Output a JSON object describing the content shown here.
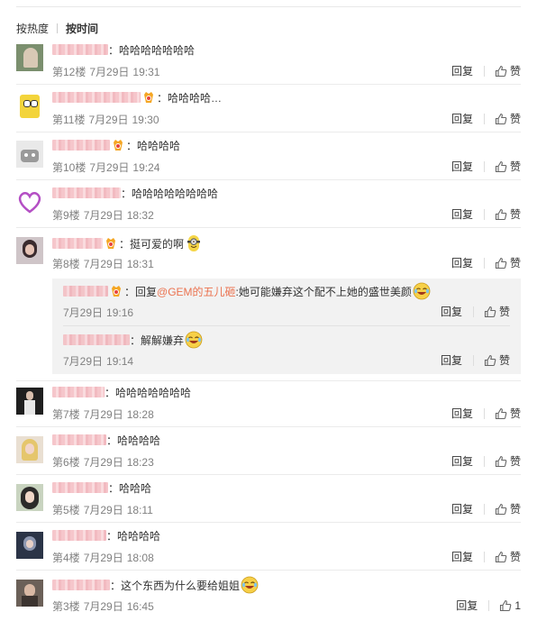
{
  "sort": {
    "hot": "按热度",
    "time": "按时间"
  },
  "actions": {
    "reply": "回复",
    "like": "赞"
  },
  "colors": {
    "link": "#eb7350",
    "meta": "#808080",
    "text": "#333333"
  },
  "comments": [
    {
      "floor": "第12楼",
      "date": "7月29日",
      "time": "19:31",
      "text": "：哈哈哈哈哈哈哈",
      "vip": false,
      "likes": ""
    },
    {
      "floor": "第11楼",
      "date": "7月29日",
      "time": "19:30",
      "text": "：哈哈哈哈…",
      "vip": true,
      "likes": ""
    },
    {
      "floor": "第10楼",
      "date": "7月29日",
      "time": "19:24",
      "text": "：哈哈哈哈",
      "vip": true,
      "likes": ""
    },
    {
      "floor": "第9楼",
      "date": "7月29日",
      "time": "18:32",
      "text": "：哈哈哈哈哈哈哈哈",
      "vip": false,
      "likes": ""
    },
    {
      "floor": "第8楼",
      "date": "7月29日",
      "time": "18:31",
      "text": "：挺可爱的啊",
      "vip": true,
      "likes": "",
      "replies": [
        {
          "date": "7月29日",
          "time": "19:16",
          "prefix": "：回复",
          "mention": "@GEM的五儿砸",
          "text": ":她可能嫌弃这个配不上她的盛世美颜",
          "vip": true
        },
        {
          "date": "7月29日",
          "time": "19:14",
          "prefix": "",
          "mention": "",
          "text": "：解解嫌弃",
          "vip": false
        }
      ]
    },
    {
      "floor": "第7楼",
      "date": "7月29日",
      "time": "18:28",
      "text": "：哈哈哈哈哈哈哈",
      "vip": false,
      "likes": ""
    },
    {
      "floor": "第6楼",
      "date": "7月29日",
      "time": "18:23",
      "text": "：哈哈哈哈",
      "vip": false,
      "likes": ""
    },
    {
      "floor": "第5楼",
      "date": "7月29日",
      "time": "18:11",
      "text": "：哈哈哈",
      "vip": false,
      "likes": ""
    },
    {
      "floor": "第4楼",
      "date": "7月29日",
      "time": "18:08",
      "text": "：哈哈哈哈",
      "vip": false,
      "likes": ""
    },
    {
      "floor": "第3楼",
      "date": "7月29日",
      "time": "16:45",
      "text": "：这个东西为什么要给姐姐",
      "vip": false,
      "likes": "1"
    }
  ]
}
